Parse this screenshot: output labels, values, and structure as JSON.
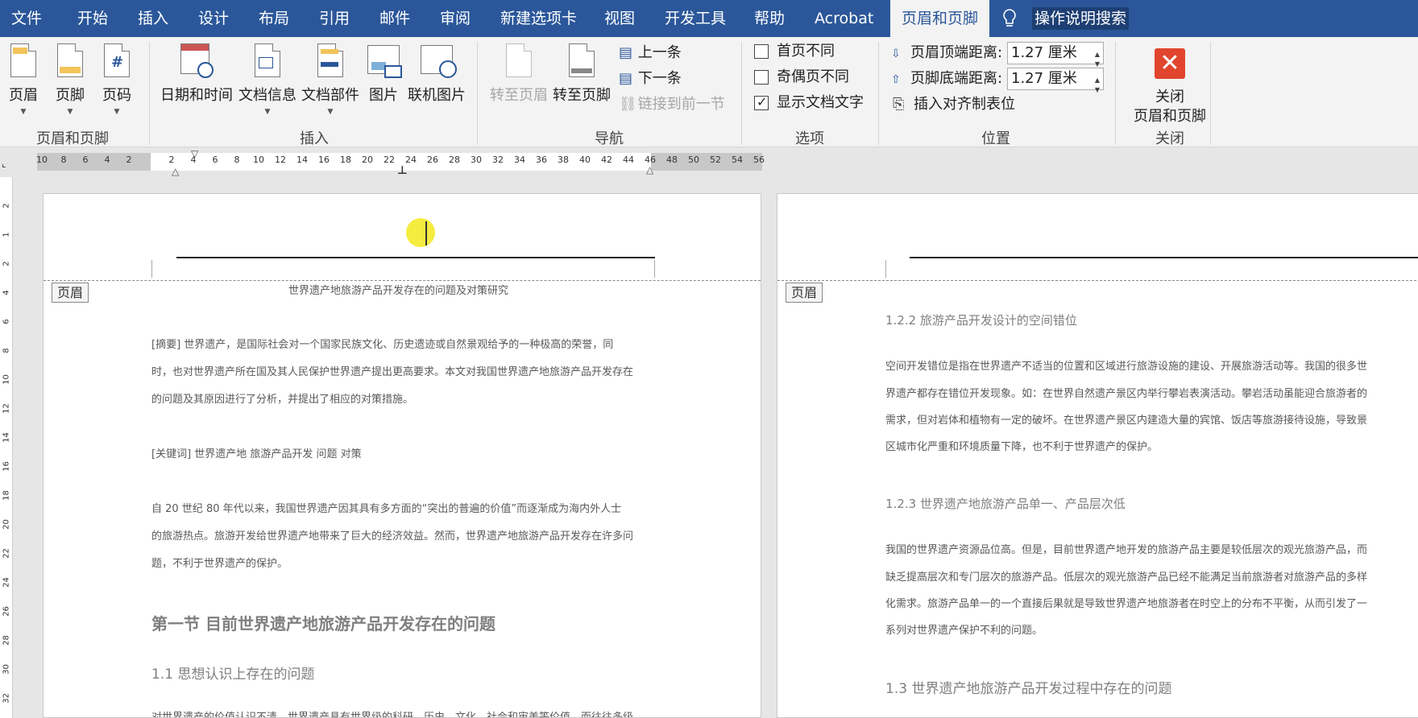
{
  "menu": {
    "tabs": [
      "文件",
      "开始",
      "插入",
      "设计",
      "布局",
      "引用",
      "邮件",
      "审阅",
      "新建选项卡",
      "视图",
      "开发工具",
      "帮助",
      "Acrobat",
      "页眉和页脚"
    ],
    "active_tab": "页眉和页脚",
    "tell_me": "操作说明搜索"
  },
  "ribbon": {
    "group_header_footer": {
      "label": "页眉和页脚",
      "header": "页眉",
      "footer": "页脚",
      "page_number": "页码"
    },
    "group_insert": {
      "label": "插入",
      "date_time": "日期和时间",
      "doc_info": "文档信息",
      "doc_parts": "文档部件",
      "picture": "图片",
      "online_picture": "联机图片"
    },
    "group_nav": {
      "label": "导航",
      "goto_header": "转至页眉",
      "goto_footer": "转至页脚",
      "previous": "上一条",
      "next": "下一条",
      "link_previous": "链接到前一节"
    },
    "group_options": {
      "label": "选项",
      "different_first": "首页不同",
      "different_odd_even": "奇偶页不同",
      "show_doc_text": "显示文档文字",
      "show_doc_text_checked": true
    },
    "group_position": {
      "label": "位置",
      "header_from_top_label": "页眉顶端距离:",
      "header_from_top_value": "1.27 厘米",
      "footer_from_bottom_label": "页脚底端距离:",
      "footer_from_bottom_value": "1.27 厘米",
      "insert_align_tab": "插入对齐制表位"
    },
    "group_close": {
      "label": "关闭",
      "close_line1": "关闭",
      "close_line2": "页眉和页脚"
    }
  },
  "ruler": {
    "left_ticks": [
      "10",
      "8",
      "6",
      "4",
      "2"
    ],
    "right_ticks": [
      "2",
      "4",
      "6",
      "8",
      "10",
      "12",
      "14",
      "16",
      "18",
      "20",
      "22",
      "24",
      "26",
      "28",
      "30",
      "32",
      "34",
      "36",
      "38",
      "40",
      "42",
      "44",
      "46",
      "48",
      "50",
      "52",
      "54",
      "56"
    ],
    "vertical_ticks": [
      "2",
      "1",
      "2",
      "4",
      "6",
      "8",
      "10",
      "12",
      "14",
      "16",
      "18",
      "20",
      "22",
      "24",
      "26",
      "28",
      "30",
      "32"
    ]
  },
  "page1": {
    "header_tag": "页眉",
    "running_title": "世界遗产地旅游产品开发存在的问题及对策研究",
    "abstract": [
      "[摘要] 世界遗产，是国际社会对一个国家民族文化、历史遗迹或自然景观给予的一种极高的荣誉，同",
      "时，也对世界遗产所在国及其人民保护世界遗产提出更高要求。本文对我国世界遗产地旅游产品开发存在",
      "的问题及其原因进行了分析，并提出了相应的对策措施。"
    ],
    "keywords": "[关键词]  世界遗产地    旅游产品开发    问题    对策",
    "intro": [
      "自 20 世纪 80 年代以来，我国世界遗产因其具有多方面的“突出的普遍的价值”而逐渐成为海内外人士",
      "的旅游热点。旅游开发给世界遗产地带来了巨大的经济效益。然而，世界遗产地旅游产品开发存在许多问",
      "题，不利于世界遗产的保护。"
    ],
    "section_title": "第一节      目前世界遗产地旅游产品开发存在的问题",
    "subsection": "1.1  思想认识上存在的问题",
    "cut_line": "对世界遗产的价值认识不清，世界遗产具有世界级的科研、历史、文化、社会和审美等价值，而往往多级"
  },
  "page2": {
    "header_tag": "页眉",
    "h122": "1.2.2      旅游产品开发设计的空间错位",
    "p122": [
      "空间开发错位是指在世界遗产不适当的位置和区域进行旅游设施的建设、开展旅游活动等。我国的很多世",
      "界遗产都存在错位开发现象。如：在世界自然遗产景区内举行攀岩表演活动。攀岩活动虽能迎合旅游者的",
      "需求，但对岩体和植物有一定的破坏。在世界遗产景区内建造大量的宾馆、饭店等旅游接待设施，导致景",
      "区城市化严重和环境质量下降，也不利于世界遗产的保护。"
    ],
    "h123": "1.2.3      世界遗产地旅游产品单一、产品层次低",
    "p123": [
      "我国的世界遗产资源品位高。但是，目前世界遗产地开发的旅游产品主要是较低层次的观光旅游产品，而",
      "缺乏提高层次和专门层次的旅游产品。低层次的观光旅游产品已经不能满足当前旅游者对旅游产品的多样",
      "化需求。旅游产品单一的一个直接后果就是导致世界遗产地旅游者在时空上的分布不平衡，从而引发了一",
      "系列对世界遗产保护不利的问题。"
    ],
    "h13": "1.3  世界遗产地旅游产品开发过程中存在的问题"
  }
}
